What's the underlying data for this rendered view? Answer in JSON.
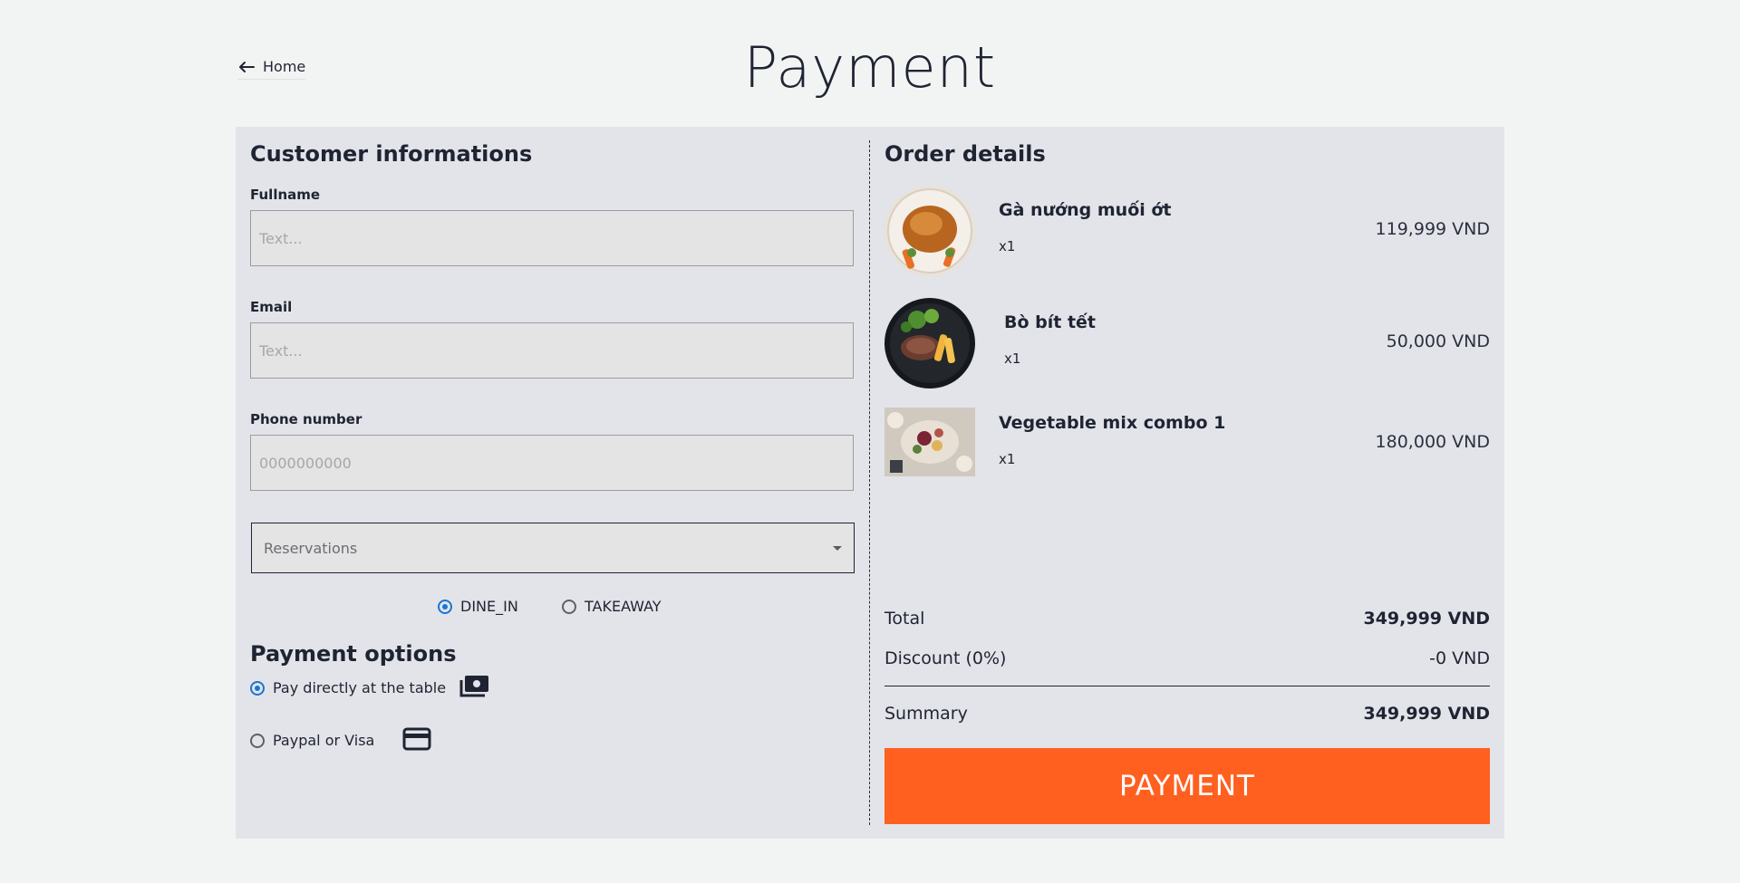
{
  "nav": {
    "home_label": "Home"
  },
  "page": {
    "title": "Payment"
  },
  "customer": {
    "section_title": "Customer informations",
    "fullname": {
      "label": "Fullname",
      "value": "",
      "placeholder": "Text..."
    },
    "email": {
      "label": "Email",
      "value": "",
      "placeholder": "Text..."
    },
    "phone": {
      "label": "Phone number",
      "value": "",
      "placeholder": "0000000000"
    },
    "reservations": {
      "placeholder": "Reservations"
    },
    "order_type": {
      "options": [
        {
          "label": "DINE_IN",
          "checked": true
        },
        {
          "label": "TAKEAWAY",
          "checked": false
        }
      ]
    }
  },
  "payment_options": {
    "section_title": "Payment options",
    "options": [
      {
        "label": "Pay directly at the table",
        "checked": true,
        "icon": "cash-icon"
      },
      {
        "label": "Paypal or Visa",
        "checked": false,
        "icon": "credit-card-icon"
      }
    ]
  },
  "order": {
    "section_title": "Order details",
    "items": [
      {
        "name": "Gà nướng muối ớt",
        "qty": "x1",
        "price": "119,999 VND",
        "image": "roast-chicken"
      },
      {
        "name": "Bò bít tết",
        "qty": "x1",
        "price": "50,000 VND",
        "image": "beef-steak"
      },
      {
        "name": "Vegetable mix combo 1",
        "qty": "x1",
        "price": "180,000 VND",
        "image": "vegetable-platter"
      }
    ],
    "total_label": "Total",
    "total_value": "349,999 VND",
    "discount_label": "Discount (0%)",
    "discount_value": "-0 VND",
    "summary_label": "Summary",
    "summary_value": "349,999 VND",
    "pay_button": "PAYMENT"
  },
  "colors": {
    "accent": "#ff6020",
    "radio_selected": "#1976d2",
    "panel_bg": "#e3e4e9",
    "page_bg": "#f2f4f3"
  }
}
